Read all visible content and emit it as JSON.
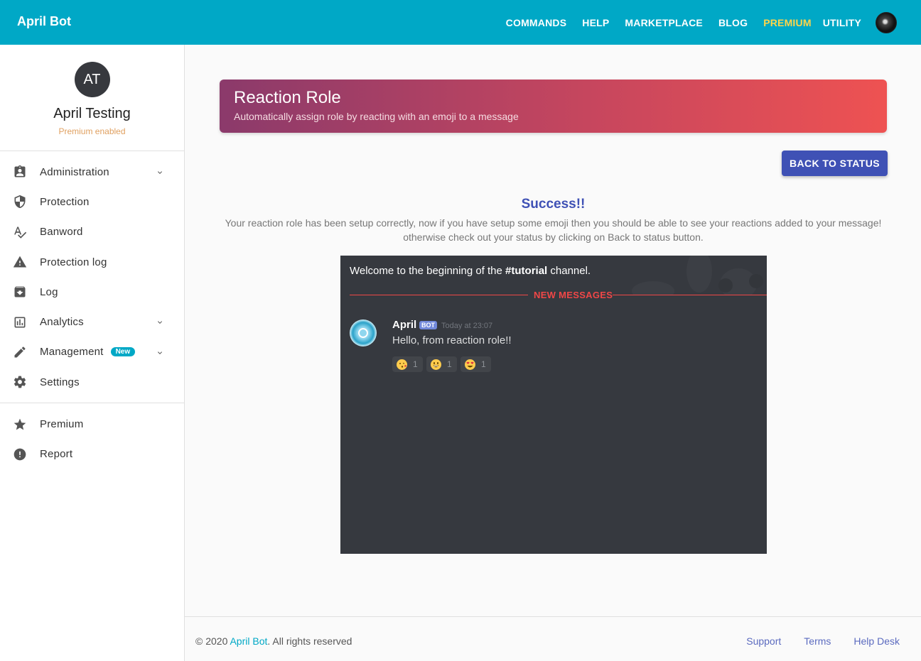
{
  "header": {
    "brand": "April Bot",
    "nav": [
      "COMMANDS",
      "HELP",
      "MARKETPLACE",
      "BLOG",
      "PREMIUM",
      "UTILITY"
    ],
    "accent_color": "#00a8c6",
    "premium_color": "#ffd54a"
  },
  "sidebar": {
    "avatar_initials": "AT",
    "name": "April Testing",
    "subtitle": "Premium enabled",
    "items": [
      {
        "label": "Administration",
        "icon": "clipboard-account-icon",
        "has_chevron": true
      },
      {
        "label": "Protection",
        "icon": "shield-icon",
        "has_chevron": false
      },
      {
        "label": "Banword",
        "icon": "spellcheck-icon",
        "has_chevron": false
      },
      {
        "label": "Protection log",
        "icon": "warning-icon",
        "has_chevron": false
      },
      {
        "label": "Log",
        "icon": "archive-icon",
        "has_chevron": false
      },
      {
        "label": "Analytics",
        "icon": "chart-icon",
        "has_chevron": true
      },
      {
        "label": "Management",
        "icon": "pencil-icon",
        "has_chevron": true,
        "badge": "New"
      },
      {
        "label": "Settings",
        "icon": "gear-icon",
        "has_chevron": false
      }
    ],
    "bottom_items": [
      {
        "label": "Premium",
        "icon": "star-icon"
      },
      {
        "label": "Report",
        "icon": "alert-circle-icon"
      }
    ]
  },
  "main": {
    "banner_title": "Reaction Role",
    "banner_subtitle": "Automatically assign role by reacting with an emoji to a message",
    "back_button": "BACK TO STATUS",
    "success_title": "Success!!",
    "success_line1": "Your reaction role has been setup correctly, now if you have setup some emoji then you should be able to see your reactions added to your message!",
    "success_line2": "otherwise check out your status by clicking on Back to status button."
  },
  "discord": {
    "welcome_prefix": "Welcome to the beginning of the ",
    "welcome_channel": "#tutorial",
    "welcome_suffix": " channel.",
    "new_messages": "NEW MESSAGES",
    "author": "April",
    "bot_tag": "BOT",
    "timestamp": "Today at 23:07",
    "message": "Hello, from reaction role!!",
    "reactions": [
      {
        "emoji": "kissing-heart-emoji-icon",
        "count": "1"
      },
      {
        "emoji": "grinning-emoji-icon",
        "count": "1"
      },
      {
        "emoji": "heart-eyes-emoji-icon",
        "count": "1"
      }
    ]
  },
  "footer": {
    "copyright_prefix": "© 2020 ",
    "copyright_brand": "April Bot",
    "copyright_suffix": ". All rights reserved",
    "links": [
      "Support",
      "Terms",
      "Help Desk"
    ]
  }
}
